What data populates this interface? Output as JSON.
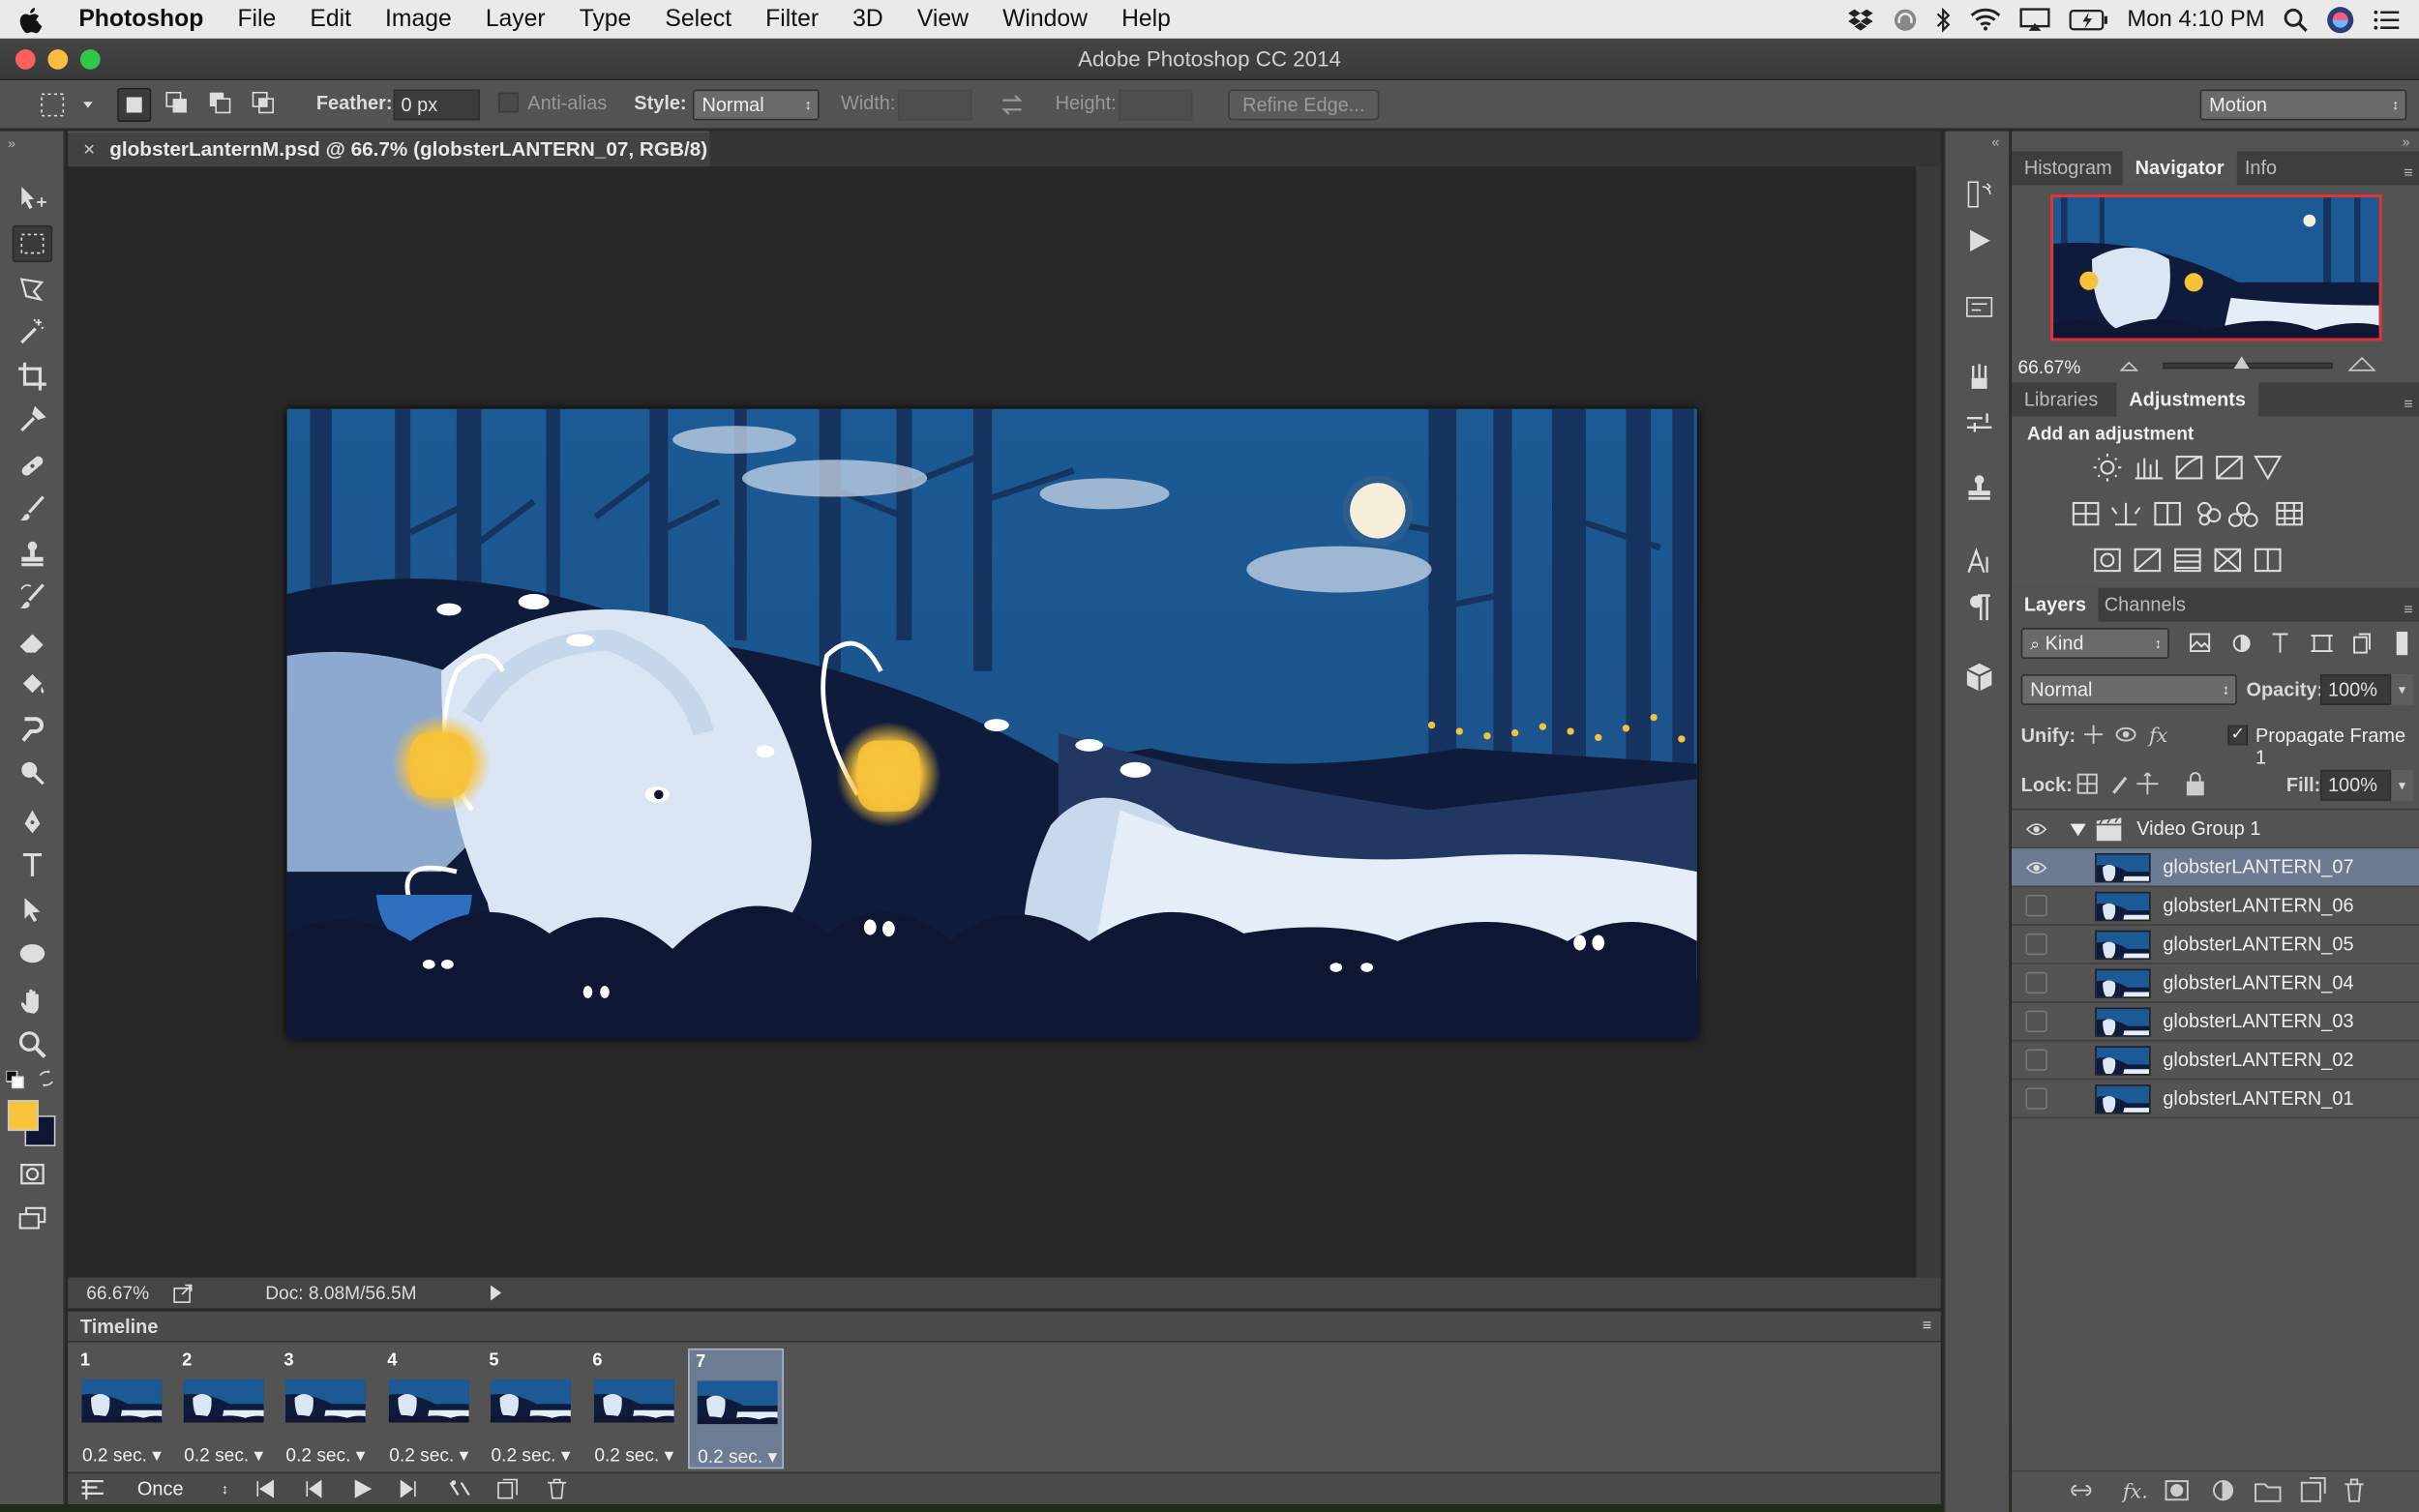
{
  "menubar": {
    "app": "Photoshop",
    "items": [
      "File",
      "Edit",
      "Image",
      "Layer",
      "Type",
      "Select",
      "Filter",
      "3D",
      "View",
      "Window",
      "Help"
    ],
    "clock": "Mon 4:10 PM"
  },
  "window": {
    "title": "Adobe Photoshop CC 2014"
  },
  "options": {
    "feather_label": "Feather:",
    "feather_value": "0 px",
    "antialias_label": "Anti-alias",
    "style_label": "Style:",
    "style_value": "Normal",
    "width_label": "Width:",
    "height_label": "Height:",
    "refine_label": "Refine Edge...",
    "workspace": "Motion"
  },
  "document": {
    "tab": "globsterLanternM.psd @ 66.7% (globsterLANTERN_07, RGB/8)",
    "zoom": "66.67%",
    "doc_size": "Doc: 8.08M/56.5M"
  },
  "timeline": {
    "title": "Timeline",
    "frames": [
      {
        "num": "1",
        "delay": "0.2 sec."
      },
      {
        "num": "2",
        "delay": "0.2 sec."
      },
      {
        "num": "3",
        "delay": "0.2 sec."
      },
      {
        "num": "4",
        "delay": "0.2 sec."
      },
      {
        "num": "5",
        "delay": "0.2 sec."
      },
      {
        "num": "6",
        "delay": "0.2 sec."
      },
      {
        "num": "7",
        "delay": "0.2 sec."
      }
    ],
    "selected_frame": "7",
    "loop": "Once"
  },
  "navigator": {
    "tabs": [
      "Histogram",
      "Navigator",
      "Info"
    ],
    "active": "Navigator",
    "zoom": "66.67%"
  },
  "adjustments": {
    "tabs": [
      "Libraries",
      "Adjustments"
    ],
    "active": "Adjustments",
    "heading": "Add an adjustment"
  },
  "layers": {
    "tabs": [
      "Layers",
      "Channels"
    ],
    "active": "Layers",
    "filter": "Kind",
    "blend_mode": "Normal",
    "opacity_label": "Opacity:",
    "opacity": "100%",
    "unify_label": "Unify:",
    "propagate_label": "Propagate Frame 1",
    "lock_label": "Lock:",
    "fill_label": "Fill:",
    "fill": "100%",
    "group": "Video Group 1",
    "items": [
      {
        "name": "globsterLANTERN_07",
        "visible": true,
        "selected": true
      },
      {
        "name": "globsterLANTERN_06",
        "visible": false,
        "selected": false
      },
      {
        "name": "globsterLANTERN_05",
        "visible": false,
        "selected": false
      },
      {
        "name": "globsterLANTERN_04",
        "visible": false,
        "selected": false
      },
      {
        "name": "globsterLANTERN_03",
        "visible": false,
        "selected": false
      },
      {
        "name": "globsterLANTERN_02",
        "visible": false,
        "selected": false
      },
      {
        "name": "globsterLANTERN_01",
        "visible": false,
        "selected": false
      }
    ]
  },
  "colors": {
    "foreground": "#f9c43c",
    "background": "#0f1633",
    "selection_highlight": "#6c7a92"
  },
  "icons": {
    "tools": [
      "move-icon",
      "marquee-icon",
      "lasso-icon",
      "magic-wand-icon",
      "crop-icon",
      "eyedropper-icon",
      "healing-brush-icon",
      "brush-icon",
      "clone-stamp-icon",
      "history-brush-icon",
      "eraser-icon",
      "paint-bucket-icon",
      "smudge-icon",
      "dodge-icon",
      "pen-icon",
      "type-icon",
      "path-selection-icon",
      "ellipse-icon",
      "hand-icon",
      "zoom-icon"
    ]
  }
}
